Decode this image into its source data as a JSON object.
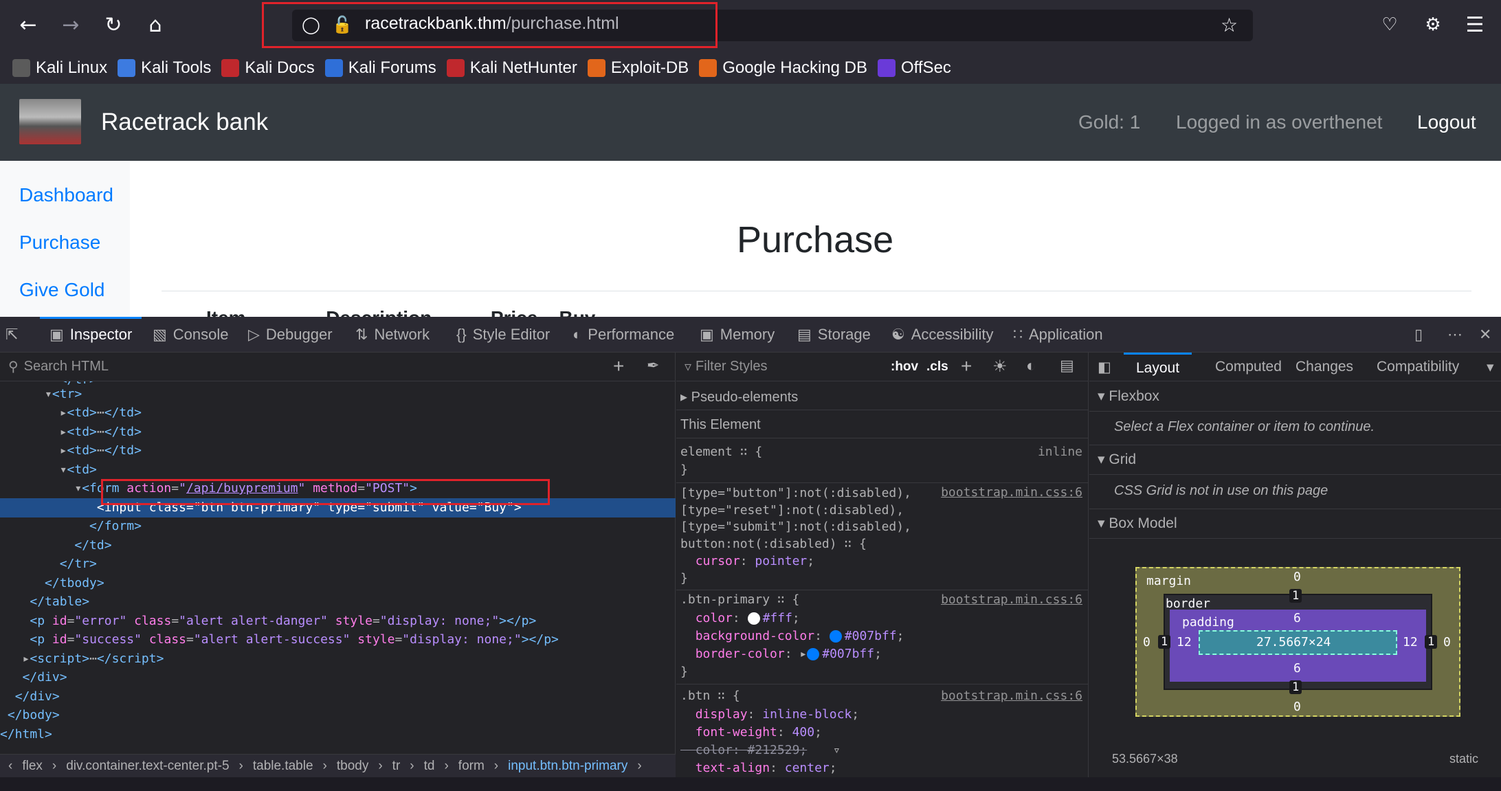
{
  "browser": {
    "url_host": "racetrackbank.thm",
    "url_path": "/purchase.html",
    "bookmarks": [
      "Kali Linux",
      "Kali Tools",
      "Kali Docs",
      "Kali Forums",
      "Kali NetHunter",
      "Exploit-DB",
      "Google Hacking DB",
      "OffSec"
    ],
    "bookmark_colors": [
      "#5b5b5b",
      "#3d7be0",
      "#c0282d",
      "#2f6fd8",
      "#c0282d",
      "#e2661b",
      "#e2661b",
      "#6a3ad8"
    ]
  },
  "site": {
    "brand": "Racetrack bank",
    "gold": "Gold: 1",
    "logged_in": "Logged in as overthenet",
    "logout": "Logout",
    "sidebar": [
      "Dashboard",
      "Purchase",
      "Give Gold"
    ],
    "page_title": "Purchase",
    "table_header_clipped": "Item               Description           Price    Buy"
  },
  "devtools": {
    "tabs": [
      "Inspector",
      "Console",
      "Debugger",
      "Network",
      "Style Editor",
      "Performance",
      "Memory",
      "Storage",
      "Accessibility",
      "Application"
    ],
    "search_placeholder": "Search HTML",
    "filter_placeholder": "Filter Styles",
    "hov": ":hov",
    "cls": ".cls",
    "layout_tabs": [
      "Layout",
      "Computed",
      "Changes",
      "Compatibility"
    ],
    "breadcrumbs": [
      "flex",
      "div.container.text-center.pt-5",
      "table.table",
      "tbody",
      "tr",
      "td",
      "form",
      "input.btn.btn-primary"
    ],
    "rules": {
      "pseudo": "Pseudo-elements",
      "this_element": "This Element",
      "element_line": "element ∷ {",
      "inline": "inline",
      "sel1": "[type=\"button\"]:not(:disabled),\n[type=\"reset\"]:not(:disabled),\n[type=\"submit\"]:not(:disabled),\nbutton:not(:disabled) ∷ {",
      "src": "bootstrap.min.css:6",
      "cursor": "cursor: pointer;",
      "btn_primary": ".btn-primary ∷ {",
      "color": "#fff",
      "bgcolor": "#007bff",
      "bordercolor": "#007bff",
      "btn": ".btn ∷ {",
      "display": "inline-block",
      "font_weight": "400",
      "struck_color": "color: #212529;",
      "text_align": "center"
    },
    "layout": {
      "flexbox": "Flexbox",
      "flexbox_msg": "Select a Flex container or item to continue.",
      "grid": "Grid",
      "grid_msg": "CSS Grid is not in use on this page",
      "box_model": "Box Model",
      "margin_label": "margin",
      "border_label": "border",
      "padding_label": "padding",
      "content_size": "27.5667×24",
      "margin_top": "0",
      "margin_bottom": "0",
      "margin_left": "0",
      "margin_right": "0",
      "border_top": "1",
      "border_bottom": "1",
      "border_left": "1",
      "border_right": "1",
      "padding_top": "6",
      "padding_bottom": "6",
      "padding_left": "12",
      "padding_right": "12",
      "element_size": "53.5667×38",
      "position": "static"
    }
  }
}
